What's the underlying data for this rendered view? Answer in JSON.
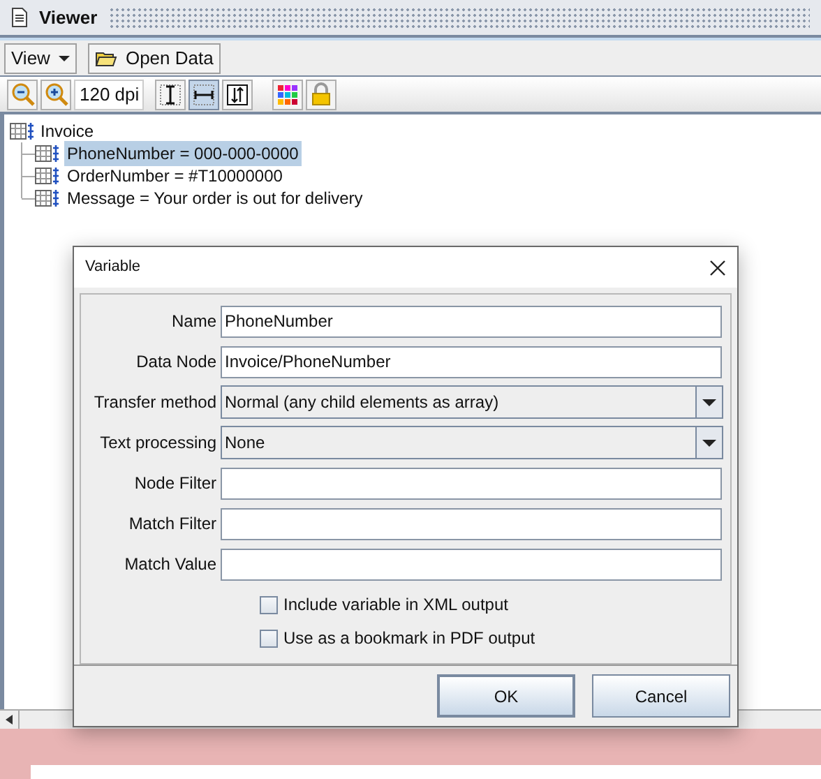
{
  "window": {
    "title": "Viewer"
  },
  "toolbar": {
    "view_menu": "View",
    "open_button": "Open Data"
  },
  "zoom_bar": {
    "dpi": "120 dpi",
    "layout_buttons": [
      {
        "selected": false
      },
      {
        "selected": true
      },
      {
        "selected": false
      }
    ]
  },
  "tree": {
    "label": "Invoice",
    "children": [
      {
        "label": "PhoneNumber = 000-000-0000",
        "selected": true
      },
      {
        "label": "OrderNumber = #T10000000",
        "selected": false
      },
      {
        "label": "Message = Your order is out for delivery",
        "selected": false
      }
    ]
  },
  "dialog": {
    "title": "Variable",
    "fields": [
      {
        "kind": "text",
        "label": "Name",
        "value": "PhoneNumber"
      },
      {
        "kind": "text",
        "label": "Data Node",
        "value": "Invoice/PhoneNumber"
      },
      {
        "kind": "select",
        "label": "Transfer method",
        "value": "Normal (any child elements as array)"
      },
      {
        "kind": "select",
        "label": "Text processing",
        "value": "None"
      },
      {
        "kind": "text",
        "label": "Node Filter"
      },
      {
        "kind": "text",
        "label": "Match Filter"
      },
      {
        "kind": "text",
        "label": "Match Value"
      }
    ],
    "checkboxes": [
      {
        "label": "Include variable in XML output",
        "checked": false
      },
      {
        "label": "Use as a bookmark in PDF output",
        "checked": false
      }
    ],
    "buttons": [
      {
        "label": "OK",
        "default": true
      },
      {
        "label": "Cancel",
        "default": false
      }
    ]
  }
}
